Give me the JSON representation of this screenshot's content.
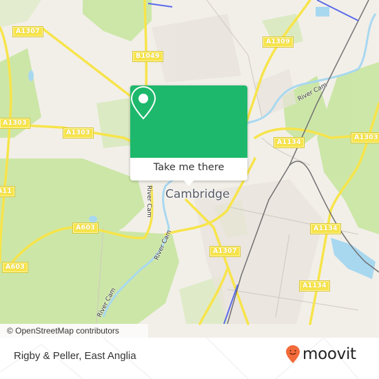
{
  "map": {
    "city_label": "Cambridge",
    "road_labels": [
      {
        "id": "a1307-nw",
        "text": "A1307"
      },
      {
        "id": "b1049",
        "text": "B1049"
      },
      {
        "id": "a1309",
        "text": "A1309"
      },
      {
        "id": "a1303-w",
        "text": "A1303"
      },
      {
        "id": "a1303-mid",
        "text": "A1303"
      },
      {
        "id": "a1303-e",
        "text": "A1303"
      },
      {
        "id": "a1134-n",
        "text": "A1134"
      },
      {
        "id": "a11",
        "text": "A11"
      },
      {
        "id": "a603-mid",
        "text": "A603"
      },
      {
        "id": "a603-w",
        "text": "A603"
      },
      {
        "id": "a1307-s",
        "text": "A1307"
      },
      {
        "id": "a1134-mid",
        "text": "A1134"
      },
      {
        "id": "a1134-s",
        "text": "A1134"
      }
    ],
    "river_labels": [
      {
        "id": "river-cam-ne",
        "text": "River Cam"
      },
      {
        "id": "river-cam-center",
        "text": "River Cam"
      },
      {
        "id": "river-cam-center-2",
        "text": "River Cam"
      },
      {
        "id": "river-cam-sw",
        "text": "River Cam"
      }
    ],
    "attribution": "© OpenStreetMap contributors",
    "colors": {
      "land": "#f2efe9",
      "park": "#c8e6a0",
      "water": "#a8d8f0",
      "road": "#f7e44a",
      "rail": "#707070"
    }
  },
  "popup": {
    "button_label": "Take me there",
    "accent_color": "#1db86b"
  },
  "footer": {
    "place_title": "Rigby & Peller, East Anglia",
    "brand": "moovit",
    "brand_color": "#f26b3a"
  }
}
